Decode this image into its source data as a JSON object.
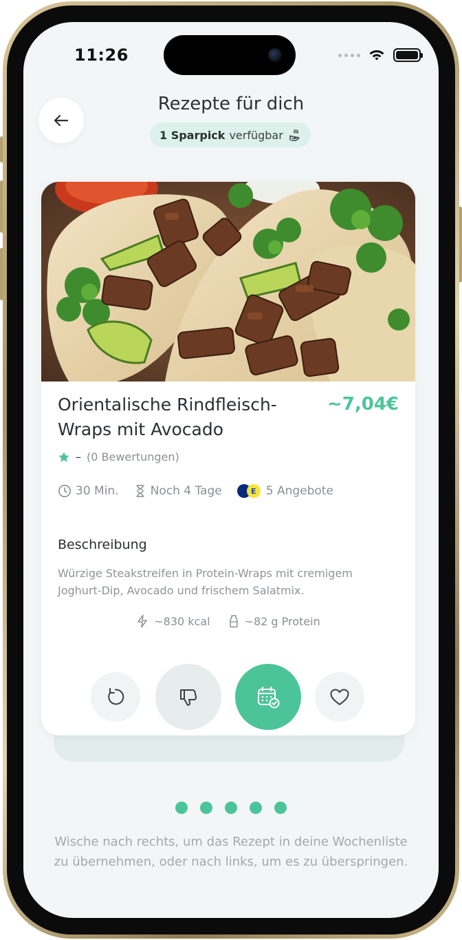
{
  "status_bar": {
    "time": "11:26"
  },
  "header": {
    "title": "Rezepte für dich",
    "sparpick_count": "1 Sparpick",
    "sparpick_suffix": "verfügbar"
  },
  "recipe": {
    "title": "Orientalische Rindfleisch-Wraps mit Avocado",
    "price": "~7,04€",
    "rating_value": "–",
    "rating_count": "(0 Bewertungen)",
    "duration": "30 Min.",
    "remaining": "Noch 4 Tage",
    "offers": "5 Angebote",
    "offer_logos": [
      "aldi-logo",
      "edeka-logo"
    ],
    "description_heading": "Beschreibung",
    "description": "Würzige Steakstreifen in Protein-Wraps mit cremigem Joghurt-Dip, Avocado und frischem Salatmix.",
    "calories": "~830 kcal",
    "protein": "~82 g Protein"
  },
  "actions": [
    {
      "name": "undo",
      "icon": "rotate-ccw-icon"
    },
    {
      "name": "dislike",
      "icon": "thumbs-down-icon"
    },
    {
      "name": "add-to-plan",
      "icon": "calendar-check-icon"
    },
    {
      "name": "favorite",
      "icon": "heart-icon"
    }
  ],
  "pagination": {
    "count": 5
  },
  "hint": "Wische nach rechts, um das Rezept in deine Wochenliste zu übernehmen, oder nach links, um es zu überspringen.",
  "colors": {
    "accent": "#4cc49a",
    "background": "#f3f6f6",
    "sparpick_bg": "#dcf1ea",
    "text": "#2b2e32",
    "muted": "#8a8f95"
  }
}
